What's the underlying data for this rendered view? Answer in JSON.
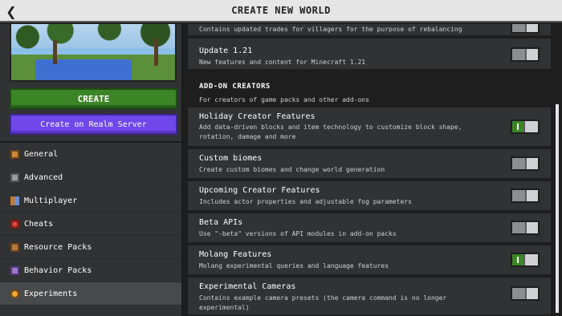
{
  "header": {
    "title": "CREATE NEW WORLD",
    "back_icon": "chevron-left-icon"
  },
  "sidebar": {
    "create_label": "CREATE",
    "realm_label": "Create on Realm Server",
    "items": [
      {
        "label": "General",
        "icon": "general-icon"
      },
      {
        "label": "Advanced",
        "icon": "advanced-icon"
      },
      {
        "label": "Multiplayer",
        "icon": "multiplayer-icon"
      },
      {
        "label": "Cheats",
        "icon": "cheats-icon"
      },
      {
        "label": "Resource Packs",
        "icon": "resource-packs-icon"
      },
      {
        "label": "Behavior Packs",
        "icon": "behavior-packs-icon"
      },
      {
        "label": "Experiments",
        "icon": "experiments-icon",
        "active": true
      }
    ]
  },
  "experiments": {
    "top_partial": {
      "desc": "Contains updated trades for villagers for the purpose of rebalancing",
      "enabled": false
    },
    "update_121": {
      "name": "Update 1.21",
      "desc": "New features and content for Minecraft 1.21",
      "enabled": false
    },
    "section": {
      "title": "ADD-ON CREATORS",
      "subtitle": "For creators of game packs and other add-ons"
    },
    "holiday": {
      "name": "Holiday Creator Features",
      "desc": "Add data-driven blocks and item technology to customize block shape, rotation, damage and more",
      "enabled": true
    },
    "biomes": {
      "name": "Custom biomes",
      "desc": "Create custom biomes and change world generation",
      "enabled": false
    },
    "upcoming": {
      "name": "Upcoming Creator Features",
      "desc": "Includes actor properties and adjustable fog parameters",
      "enabled": false
    },
    "beta_apis": {
      "name": "Beta APIs",
      "desc": "Use \"-beta\" versions of API modules in add-on packs",
      "enabled": false
    },
    "molang": {
      "name": "Molang Features",
      "desc": "Molang experimental queries and language features",
      "enabled": true
    },
    "cameras": {
      "name": "Experimental Cameras",
      "desc": "Contains example camera presets (the camera command is no longer experimental)",
      "enabled": false
    }
  },
  "colors": {
    "accent_green": "#3c8527",
    "realm_purple": "#7047ea"
  }
}
